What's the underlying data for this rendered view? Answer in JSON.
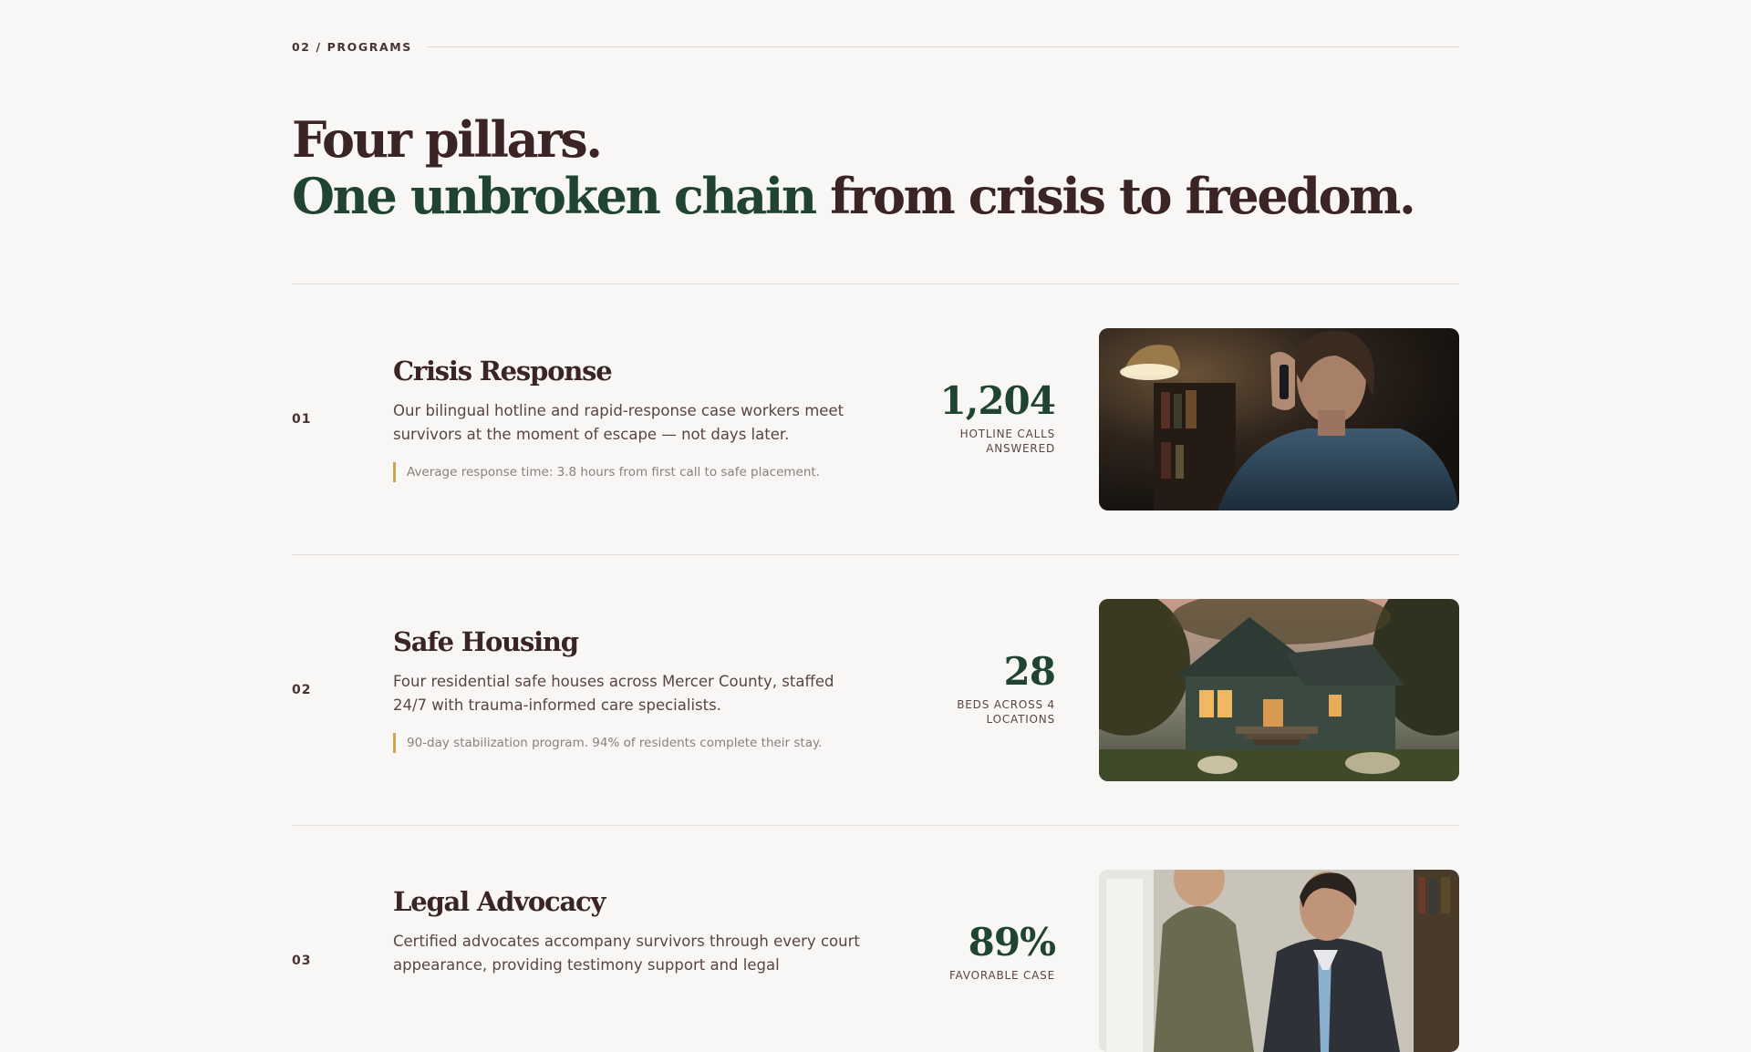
{
  "section": {
    "eyebrow": "02 / PROGRAMS"
  },
  "headline": {
    "line1": "Four pillars.",
    "line2_accent": "One unbroken chain",
    "line2_rest": " from crisis to freedom."
  },
  "programs": [
    {
      "number": "01",
      "title": "Crisis Response",
      "description": "Our bilingual hotline and rapid-response case workers meet survivors at the moment of escape — not days later.",
      "note": "Average response time: 3.8 hours from first call to safe placement.",
      "stat_value": "1,204",
      "stat_label_1": "HOTLINE CALLS",
      "stat_label_2": "ANSWERED",
      "image": "woman-on-phone-photo"
    },
    {
      "number": "02",
      "title": "Safe Housing",
      "description": "Four residential safe houses across Mercer County, staffed 24/7 with trauma-informed care specialists.",
      "note": "90-day stabilization program. 94% of residents complete their stay.",
      "stat_value": "28",
      "stat_label_1": "BEDS ACROSS 4",
      "stat_label_2": "LOCATIONS",
      "image": "safe-house-photo"
    },
    {
      "number": "03",
      "title": "Legal Advocacy",
      "description": "Certified advocates accompany survivors through every court appearance, providing testimony support and legal",
      "stat_value": "89%",
      "stat_label_1": "FAVORABLE CASE",
      "image": "legal-advocates-photo"
    }
  ],
  "colors": {
    "background": "#f8f7f5",
    "heading": "#3a2424",
    "accent_green": "#1f4434",
    "note_bar": "#d4a24c"
  }
}
